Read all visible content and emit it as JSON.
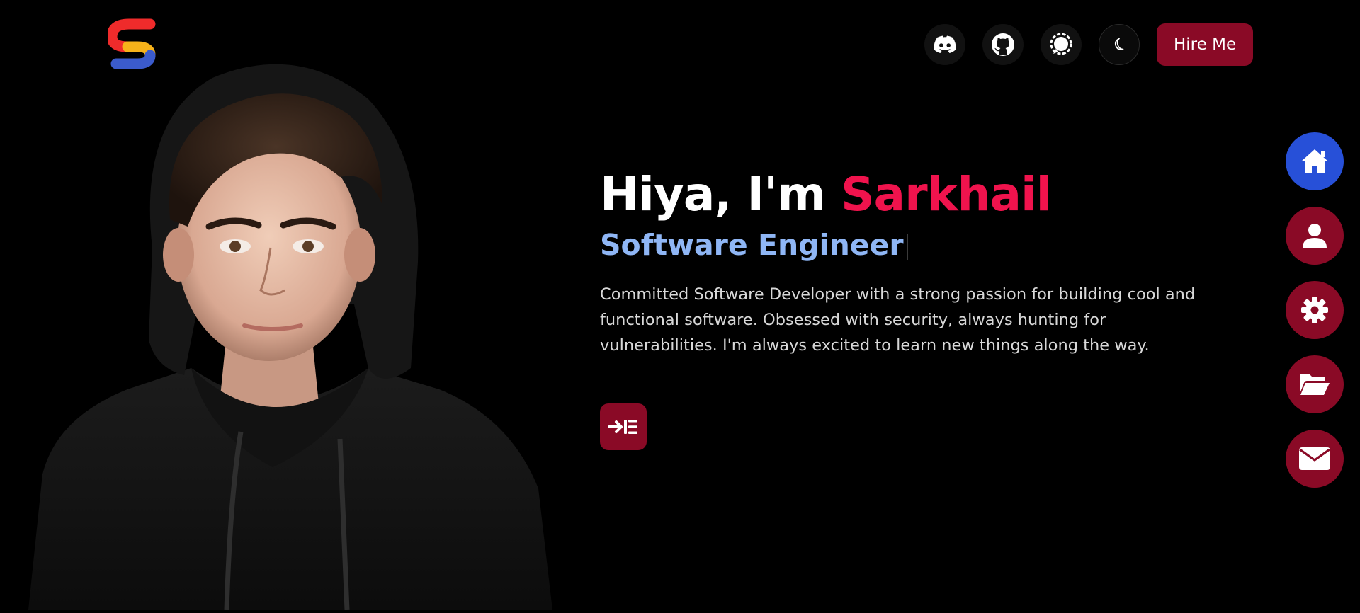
{
  "brand": {
    "logo_icon": "s-logo-icon"
  },
  "header": {
    "social": [
      {
        "name": "discord",
        "icon": "discord-icon"
      },
      {
        "name": "github",
        "icon": "github-icon"
      },
      {
        "name": "signal",
        "icon": "chat-bubble-icon"
      }
    ],
    "theme_toggle_icon": "moon-icon",
    "hire_label": "Hire Me"
  },
  "hero": {
    "greeting": "Hiya, I'm",
    "name": "Sarkhail",
    "role": "Software Engineer",
    "description": "Committed Software Developer with a strong passion for building cool and functional software. Obsessed with security, always hunting for vulnerabilities. I'm always excited to learn new things along the way.",
    "cta_icon": "arrow-into-list-icon"
  },
  "side_nav": [
    {
      "id": "home",
      "icon": "home-icon",
      "active": true
    },
    {
      "id": "about",
      "icon": "user-icon",
      "active": false
    },
    {
      "id": "skills",
      "icon": "gear-icon",
      "active": false
    },
    {
      "id": "projects",
      "icon": "folder-open-icon",
      "active": false
    },
    {
      "id": "contact",
      "icon": "envelope-icon",
      "active": false
    }
  ],
  "colors": {
    "background": "#000000",
    "accent_red": "#8a0a26",
    "name_pink": "#f0134d",
    "role_blue": "#8fb6f5",
    "nav_active_blue": "#2750d8",
    "logo_red": "#ef2b2b",
    "logo_yellow": "#f6b21a",
    "logo_blue": "#3b5bcc"
  }
}
